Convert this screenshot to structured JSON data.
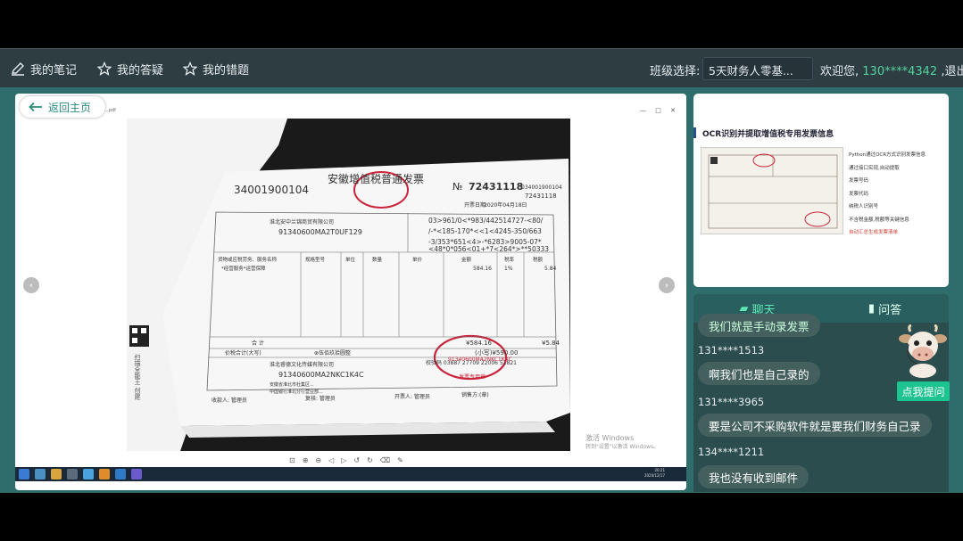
{
  "nav": {
    "notes": "我的笔记",
    "questions": "我的答疑",
    "mistakes": "我的错题",
    "class_label": "班级选择:",
    "class_value": "5天财务人零基...",
    "welcome_prefix": "欢迎您,",
    "phone": "130****4342",
    "logout": ",退出"
  },
  "video": {
    "back_label": "返回主页",
    "screen_title": "...pdf",
    "activate_line1": "激活 Windows",
    "activate_line2": "转到\"设置\"以激活 Windows。",
    "tray_time": "20:21",
    "tray_date": "2020/12/17",
    "invoice": {
      "province_title": "安徽增值税普通发票",
      "code_left": "34001900104",
      "number_prefix": "№",
      "number": "72431118",
      "code_right": "034001900104",
      "number_right": "72431118",
      "date_label": "开票日期:",
      "date": "2020年04月18日",
      "buyer_name": "淮北安中兰锦商贸有限公司",
      "buyer_tax_id": "91340600MA2T0UF129",
      "cipher_1": "03>961/0<*983/442514727-<80/",
      "cipher_2": "/-*<185-170*<<1<4245-350/663",
      "cipher_3": "-3/353*651<4>-*6283>9005-07*",
      "cipher_4": "<48*0*056<01+*7<264*>**50333",
      "col_goods": "货物或应税劳务、服务名称",
      "col_spec": "规格型号",
      "col_unit": "单位",
      "col_qty": "数量",
      "col_price": "单价",
      "col_amount": "金额",
      "col_rate": "税率",
      "col_tax": "税额",
      "item_name": "*经营服务*运营保障",
      "item_amount": "584.16",
      "item_rate": "1%",
      "item_tax": "5.84",
      "total_label": "合    计",
      "total_amount": "¥584.16",
      "total_tax": "¥5.84",
      "sum_label": "价税合计(大写)",
      "sum_words": "⊗伍佰玖拾圆整",
      "sum_small": "(小写)¥590.00",
      "seller_name": "淮北睿德文化传媒有限公司",
      "seller_tax_id": "91340600MA2NKC1K4C",
      "seller_addr": "安徽省淮北市杜集区...",
      "seller_bank": "中国银行淮北分行营业部...",
      "remark_label": "备注",
      "remark_text": "校验码 03887 27709 22006 51821",
      "payee": "收款人: 管理员",
      "reviewer": "复核: 管理员",
      "issuer": "开票人: 管理员",
      "seller_label": "销售方:(章)",
      "stamp_text": "91340600MA2NKC1K4C",
      "stamp_sub": "发票专用章",
      "side_text": "扫描全能王 创建"
    }
  },
  "slide": {
    "title": "OCR识别并提取增值税专用发票信息",
    "bullets": [
      "Python通过OCR方式识别发票信息",
      "通过接口实现,自动提取",
      "发票号码",
      "发票代码",
      "纳税人识别号",
      "不含税金额,税额等关键信息",
      "自动汇总生成发票清单"
    ]
  },
  "chat": {
    "tab_chat": "聊天",
    "tab_qa": "问答",
    "partial_msg": "我们就是手动录发票",
    "messages": [
      {
        "name": "131****1513",
        "text": "啊我们也是自己录的"
      },
      {
        "name": "131****3965",
        "text": "要是公司不采购软件就是要我们财务自己录"
      },
      {
        "name": "134****1211",
        "text": "我也没有收到邮件"
      }
    ],
    "ask_button": "点我提问"
  }
}
